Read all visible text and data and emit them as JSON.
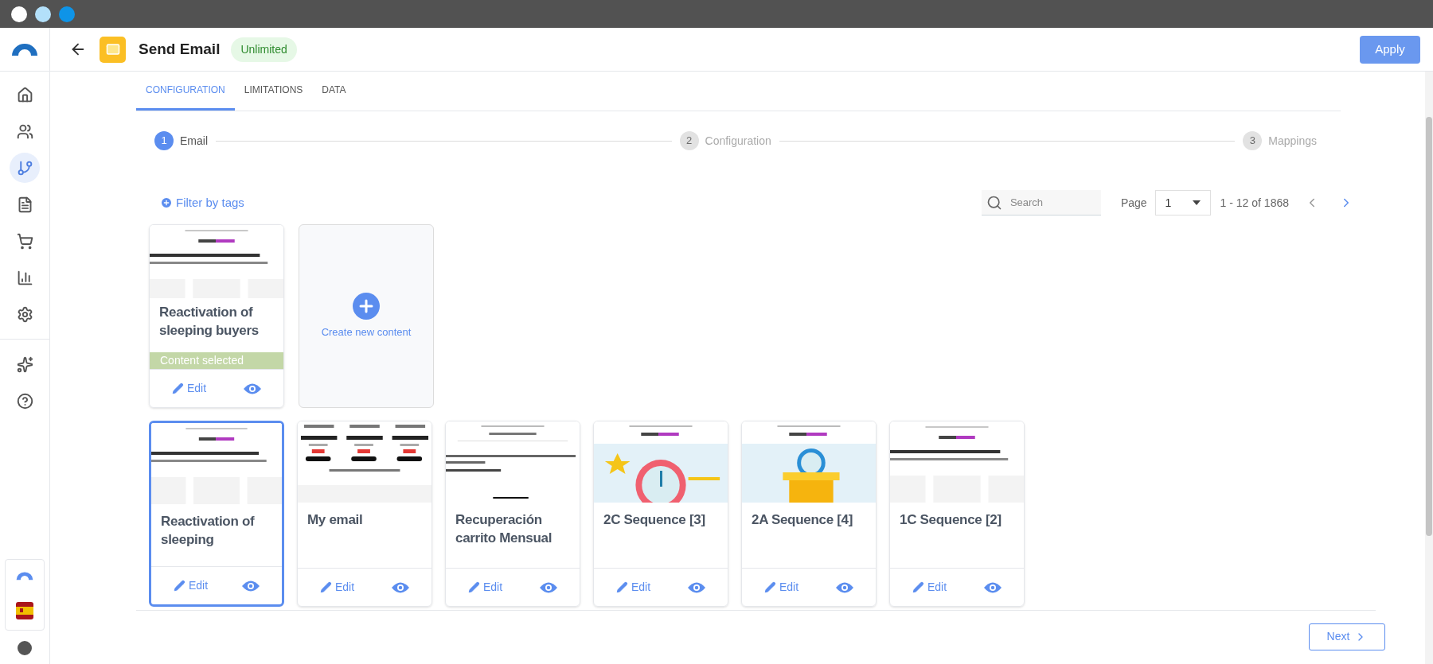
{
  "window_controls": [
    {
      "color": "#ffffff"
    },
    {
      "color": "#b3e0fa"
    },
    {
      "color": "#0e94e8"
    }
  ],
  "sidebar": {
    "items": [
      {
        "kind": "home",
        "selected": false
      },
      {
        "kind": "people",
        "selected": false
      },
      {
        "kind": "flow",
        "selected": true
      },
      {
        "kind": "document",
        "selected": false
      },
      {
        "kind": "cart",
        "selected": false
      },
      {
        "kind": "chart",
        "selected": false
      },
      {
        "kind": "settings",
        "selected": false
      },
      {
        "kind": "sparkles",
        "selected": false
      },
      {
        "kind": "help",
        "selected": false
      }
    ]
  },
  "header": {
    "title": "Send Email",
    "badge": "Unlimited",
    "apply_button": "Apply"
  },
  "tabs": [
    {
      "label": "CONFIGURATION",
      "selected": true
    },
    {
      "label": "LIMITATIONS",
      "selected": false
    },
    {
      "label": "DATA",
      "selected": false
    }
  ],
  "steps": [
    {
      "number": "1",
      "label": "Email",
      "active": true
    },
    {
      "number": "2",
      "label": "Configuration",
      "active": false
    },
    {
      "number": "3",
      "label": "Mappings",
      "active": false
    }
  ],
  "toolbar": {
    "filter_link": "Filter by tags",
    "search": {
      "placeholder": "Search"
    },
    "page_label": "Page",
    "page_value": "1",
    "range": "1 - 12 of 1868",
    "prev": {
      "disabled": true
    },
    "next": {
      "disabled": false
    }
  },
  "current_content": {
    "title": "Reactivation of sleeping buyers",
    "banner": "Content selected",
    "edit": "Edit"
  },
  "create_card": {
    "label": "Create new content"
  },
  "templates": [
    {
      "title": "Reactivation of sleeping",
      "selected": true,
      "edit": "Edit"
    },
    {
      "title": "My email",
      "selected": false,
      "edit": "Edit"
    },
    {
      "title": "Recuperación carrito Mensual",
      "selected": false,
      "edit": "Edit"
    },
    {
      "title": "2C Sequence [3]",
      "selected": false,
      "edit": "Edit"
    },
    {
      "title": "2A Sequence [4]",
      "selected": false,
      "edit": "Edit"
    },
    {
      "title": "1C Sequence [2]",
      "selected": false,
      "edit": "Edit"
    }
  ],
  "footer": {
    "next_button": "Next"
  }
}
